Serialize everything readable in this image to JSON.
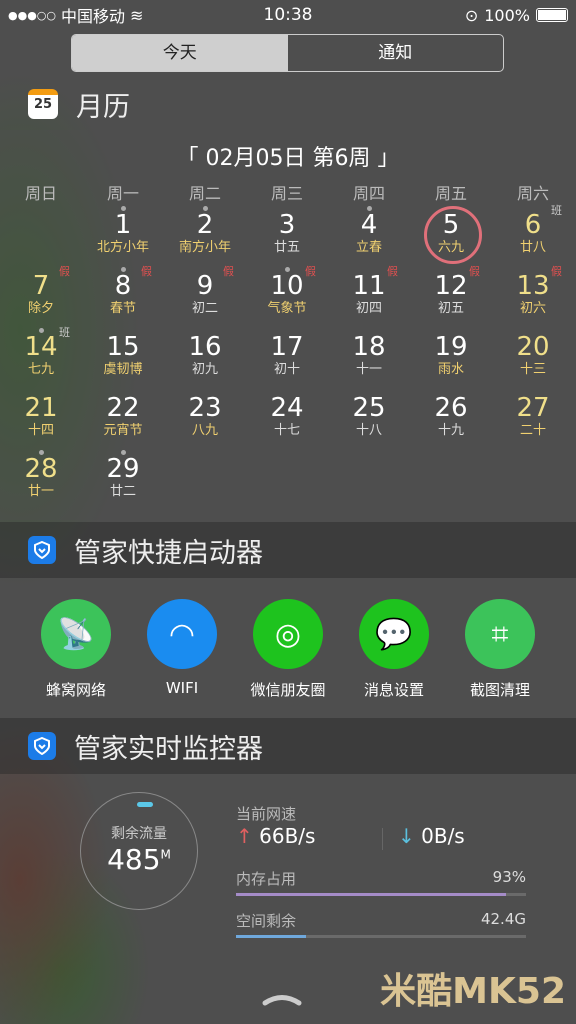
{
  "status": {
    "carrier": "中国移动",
    "time": "10:38",
    "battery": "100%",
    "battery_level": 1.0
  },
  "segment": {
    "today": "今天",
    "notifications": "通知",
    "selected": "today"
  },
  "calendar": {
    "title": "月历",
    "icon_text": "25",
    "date_title": "「 02月05日 第6周 」",
    "weekdays": [
      "周日",
      "周一",
      "周二",
      "周三",
      "周四",
      "周五",
      "周六"
    ],
    "first_weekday": 1,
    "today": 5,
    "days": [
      {
        "d": "1",
        "s": "北方小年",
        "dot": true,
        "hl": true
      },
      {
        "d": "2",
        "s": "南方小年",
        "dot": true,
        "hl": true
      },
      {
        "d": "3",
        "s": "廿五"
      },
      {
        "d": "4",
        "s": "立春",
        "dot": true,
        "hl": true
      },
      {
        "d": "5",
        "s": "六九",
        "hl": true
      },
      {
        "d": "6",
        "s": "廿八",
        "badge": "班"
      },
      {
        "d": "7",
        "s": "除夕",
        "badge": "假",
        "hl": true
      },
      {
        "d": "8",
        "s": "春节",
        "badge": "假",
        "dot": true,
        "hl": true
      },
      {
        "d": "9",
        "s": "初二",
        "badge": "假"
      },
      {
        "d": "10",
        "s": "气象节",
        "badge": "假",
        "dot": true,
        "hl": true
      },
      {
        "d": "11",
        "s": "初四",
        "badge": "假"
      },
      {
        "d": "12",
        "s": "初五",
        "badge": "假"
      },
      {
        "d": "13",
        "s": "初六",
        "badge": "假"
      },
      {
        "d": "14",
        "s": "七九",
        "badge": "班",
        "dot": true,
        "hl": true
      },
      {
        "d": "15",
        "s": "虞韧博",
        "hl": true
      },
      {
        "d": "16",
        "s": "初九"
      },
      {
        "d": "17",
        "s": "初十"
      },
      {
        "d": "18",
        "s": "十一"
      },
      {
        "d": "19",
        "s": "雨水",
        "hl": true
      },
      {
        "d": "20",
        "s": "十三"
      },
      {
        "d": "21",
        "s": "十四"
      },
      {
        "d": "22",
        "s": "元宵节",
        "hl": true
      },
      {
        "d": "23",
        "s": "八九",
        "hl": true
      },
      {
        "d": "24",
        "s": "十七"
      },
      {
        "d": "25",
        "s": "十八"
      },
      {
        "d": "26",
        "s": "十九"
      },
      {
        "d": "27",
        "s": "二十"
      },
      {
        "d": "28",
        "s": "廿一",
        "dot": true
      },
      {
        "d": "29",
        "s": "廿二",
        "dot": true
      }
    ]
  },
  "launcher": {
    "title": "管家快捷启动器",
    "apps": [
      {
        "label": "蜂窝网络",
        "icon": "cellular-tower-icon",
        "color": "#3cc35a"
      },
      {
        "label": "WIFI",
        "icon": "wifi-icon",
        "color": "#1a8cf0"
      },
      {
        "label": "微信朋友圈",
        "icon": "camera-shutter-icon",
        "color": "#1ec31e"
      },
      {
        "label": "消息设置",
        "icon": "wechat-icon",
        "color": "#1ec31e"
      },
      {
        "label": "截图清理",
        "icon": "crop-icon",
        "color": "#3cc35a"
      }
    ]
  },
  "monitor": {
    "title": "管家实时监控器",
    "data_label": "剩余流量",
    "data_value": "485",
    "data_unit": "M",
    "speed_label": "当前网速",
    "up": "66B/s",
    "down": "0B/s",
    "memory_label": "内存占用",
    "memory_value": "93%",
    "memory_fraction": 0.93,
    "storage_label": "空间剩余",
    "storage_value": "42.4G",
    "storage_fraction": 0.24
  },
  "watermark": "米酷MK52",
  "colors": {
    "weekend": "#f0df8a",
    "highlight": "#f0d070",
    "holiday_badge": "#e05050",
    "today_ring": "#e0707a",
    "memory_bar": "#a58cc8",
    "storage_bar": "#6fa8dc",
    "up_arrow": "#e06060",
    "down_arrow": "#5bc0de"
  }
}
